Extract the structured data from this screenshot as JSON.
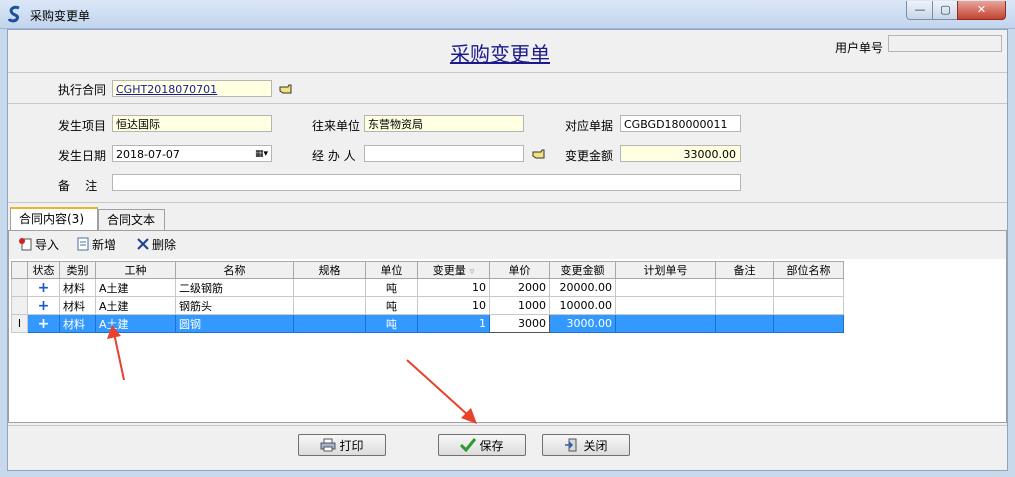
{
  "window": {
    "title": "采购变更单",
    "min_glyph": "—",
    "max_glyph": "▢",
    "close_glyph": "✕"
  },
  "header": {
    "title": "采购变更单",
    "user_doc_label": "用户单号",
    "user_doc_value": ""
  },
  "contract": {
    "label": "执行合同",
    "value": "CGHT2018070701",
    "picker_icon": "hand-pointer-icon"
  },
  "form": {
    "project_label": "发生项目",
    "project_value": "恒达国际",
    "partner_label": "往来单位",
    "partner_value": "东营物资局",
    "ref_label": "对应单据",
    "ref_value": "CGBGD180000011",
    "date_label": "发生日期",
    "date_value": "2018-07-07",
    "handler_label": "经 办 人",
    "handler_value": "",
    "amount_label": "变更金额",
    "amount_value": "33000.00",
    "note_label": "备    注",
    "note_value": ""
  },
  "tabs": [
    {
      "label": "合同内容(3)",
      "active": true
    },
    {
      "label": "合同文本",
      "active": false
    }
  ],
  "toolbar": {
    "import_label": "导入",
    "add_label": "新增",
    "delete_label": "删除"
  },
  "grid": {
    "columns": [
      "状态",
      "类别",
      "工种",
      "名称",
      "规格",
      "单位",
      "变更量",
      "单价",
      "变更金额",
      "计划单号",
      "备注",
      "部位名称"
    ],
    "rows": [
      {
        "status": "+",
        "category": "材料",
        "trade": "A土建",
        "name": "二级钢筋",
        "spec": "",
        "unit": "吨",
        "qty": "10",
        "price": "2000",
        "amount": "20000.00",
        "plan_no": "",
        "remark": "",
        "location": ""
      },
      {
        "status": "+",
        "category": "材料",
        "trade": "A土建",
        "name": "钢筋头",
        "spec": "",
        "unit": "吨",
        "qty": "10",
        "price": "1000",
        "amount": "10000.00",
        "plan_no": "",
        "remark": "",
        "location": ""
      },
      {
        "status": "+",
        "category": "材料",
        "trade": "A土建",
        "name": "圆钢",
        "spec": "",
        "unit": "吨",
        "qty": "1",
        "price": "3000",
        "amount": "3000.00",
        "plan_no": "",
        "remark": "",
        "location": ""
      }
    ],
    "row_cursor_glyph": "I",
    "selected_row": 2
  },
  "buttons": {
    "print_label": "打印",
    "save_label": "保存",
    "close_label": "关闭"
  },
  "colors": {
    "selection": "#3399ff",
    "annotation_arrow": "#e8412c",
    "title_blue": "#1a1a8c"
  }
}
